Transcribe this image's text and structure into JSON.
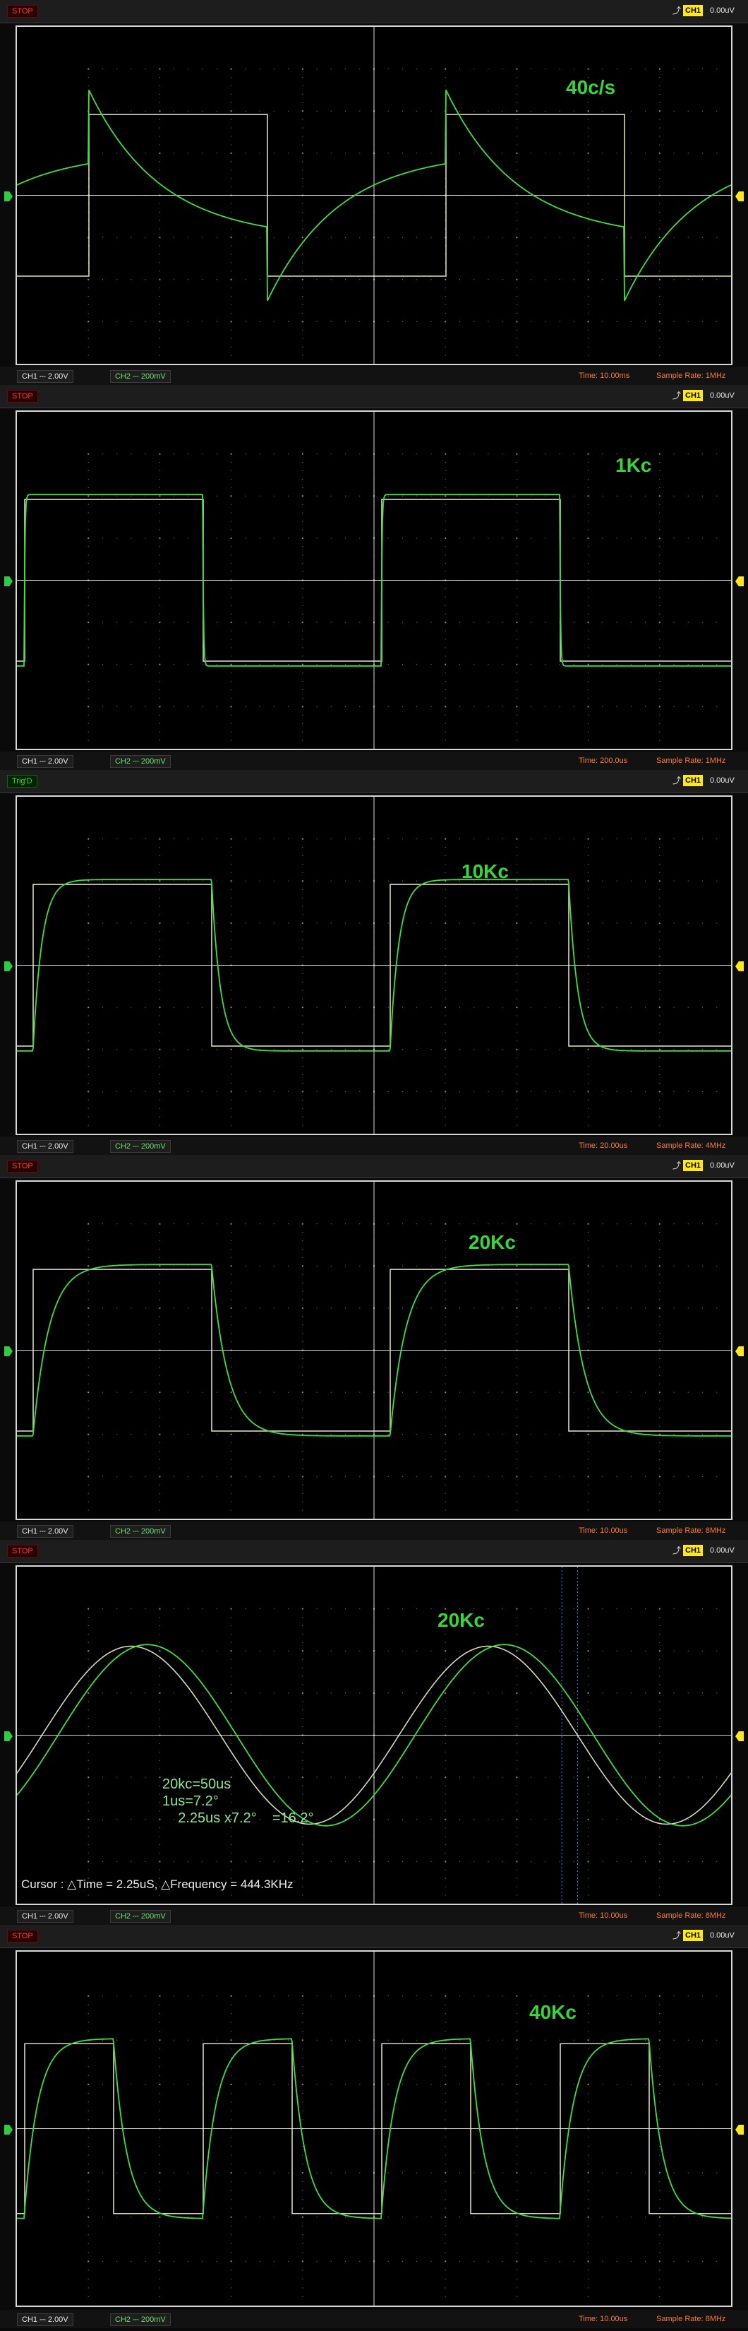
{
  "common": {
    "ch1_label": "CH1 ⎓ 2.00V",
    "ch2_label": "CH2 ⎓ 200mV",
    "trigger_channel": "CH1",
    "trigger_level": "0.00uV",
    "colors": {
      "ch1_trace": "#f2f2cc",
      "ch2_trace": "#3ee03e",
      "grid": "#ffffff",
      "status_stop": "#ff3b3b",
      "status_trig": "#33dd33",
      "info_text": "#ff7a3b",
      "badge": "#ffe81a"
    }
  },
  "panels": [
    {
      "status": "STOP",
      "status_kind": "stop",
      "freq_label": "40c/s",
      "time": "Time: 10.00ms",
      "rate": "Sample Rate: 1MHz",
      "cycles": 2,
      "phase": -0.2,
      "ch2_shape": "sawexp",
      "ch2_tau": 0.2
    },
    {
      "status": "STOP",
      "status_kind": "stop",
      "freq_label": "1Kc",
      "time": "Time: 200.0us",
      "rate": "Sample Rate: 1MHz",
      "cycles": 2,
      "phase": -0.02,
      "ch2_shape": "rc",
      "ch2_tau": 0.002
    },
    {
      "status": "Trig'D",
      "status_kind": "trig",
      "freq_label": "10Kc",
      "time": "Time: 20.00us",
      "rate": "Sample Rate: 4MHz",
      "cycles": 2,
      "phase": -0.045,
      "ch2_shape": "rc",
      "ch2_tau": 0.025
    },
    {
      "status": "STOP",
      "status_kind": "stop",
      "freq_label": "20Kc",
      "time": "Time: 10.00us",
      "rate": "Sample Rate: 8MHz",
      "cycles": 2,
      "phase": -0.045,
      "ch2_shape": "rc",
      "ch2_tau": 0.045
    },
    {
      "status": "STOP",
      "status_kind": "stop",
      "freq_label": "20Kc",
      "time": "Time: 10.00us",
      "rate": "Sample Rate: 8MHz",
      "cycles": 2,
      "phase": -0.07,
      "ch2_shape": "sine",
      "ch2_lag": 0.045,
      "notes": [
        "20kc=50us",
        "1us=7.2°",
        "    2.25us x7.2°    =16.2°"
      ],
      "cursor_text": "Cursor : △Time = 2.25uS,  △Frequency = 444.3KHz"
    },
    {
      "status": "STOP",
      "status_kind": "stop",
      "freq_label": "40Kc",
      "time": "Time: 10.00us",
      "rate": "Sample Rate: 8MHz",
      "cycles": 4,
      "phase": -0.04,
      "ch2_shape": "rc",
      "ch2_tau": 0.075
    }
  ]
}
